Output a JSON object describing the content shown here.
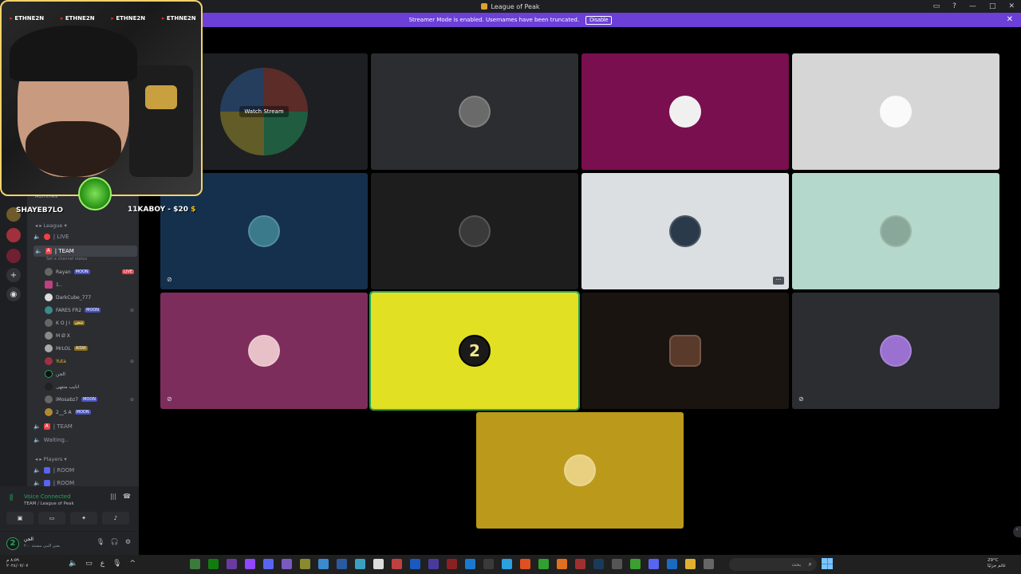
{
  "window": {
    "title": "League of Peak",
    "controls": [
      "▭",
      "?",
      "—",
      "□",
      "✕"
    ]
  },
  "banner": {
    "text": "Streamer Mode is enabled. Usernames have been truncated.",
    "button": "Disable",
    "close": "✕"
  },
  "webcam": {
    "handles": [
      "ETHNE2N",
      "ETHNE2N",
      "ETHNE2N",
      "ETHNE2N"
    ],
    "channel_name": "SHAYEB7LO",
    "donation_text": "11KABOY - $20",
    "donation_symbol": "$"
  },
  "sidebar": {
    "admins_cat": "Admines",
    "league_cat": "League",
    "live_channel": "| LIVE",
    "team_channel": "| TEAM",
    "team_status": "Set a channel status",
    "team_badge": "A",
    "users": [
      {
        "name": "Rayan",
        "tag": "MOON",
        "live": "LIVE"
      },
      {
        "name": "1..",
        "tag": ""
      },
      {
        "name": "DarkCube_777",
        "tag": ""
      },
      {
        "name": "FARES FR2",
        "tag": "MOON"
      },
      {
        "name": "K O J I",
        "tag": "شص",
        "gold": true
      },
      {
        "name": "M Ø X",
        "tag": ""
      },
      {
        "name": "MrLOL",
        "tag": "AISW",
        "gold": true
      },
      {
        "name": "Yuta",
        "tag": ""
      },
      {
        "name": "الجن",
        "tag": ""
      },
      {
        "name": "انايب منتهى",
        "tag": ""
      },
      {
        "name": "iMosabz7",
        "tag": "MOON"
      },
      {
        "name": "2__S A",
        "tag": "MOON"
      }
    ],
    "team2_channel": "| TEAM",
    "waiting_channel": "Waiting..",
    "players_cat": "Players",
    "room1": "| ROOM",
    "room2": "| ROOM"
  },
  "voice": {
    "status": "Voice Connected",
    "channel": "TEAM / League of Peak",
    "user_name": "الجن",
    "user_status": "يعني النبي مستند ٢٠٠"
  },
  "stage": {
    "watch_label": "Watch Stream",
    "two_label": "2"
  },
  "taskbar": {
    "search_placeholder": "بحث",
    "clock": "٨:٥٩ م",
    "date": "٢٠٢٤/٠٧/٠٧",
    "weather_temp": "29°C",
    "weather_desc": "غائم جزئيًا"
  },
  "colors": {
    "tile_gray": "#2b2d31",
    "tile_magenta": "#7a0f4f",
    "tile_light": "#d6d6d6",
    "tile_navy": "#14304d",
    "tile_dark": "#1d1d1d",
    "tile_white": "#dcdfe2",
    "tile_mint": "#b4d8cc",
    "tile_plum": "#7c2d5c",
    "tile_yellow": "#e2e022",
    "tile_brown": "#1a1410",
    "tile_gold": "#bb9a1b"
  }
}
